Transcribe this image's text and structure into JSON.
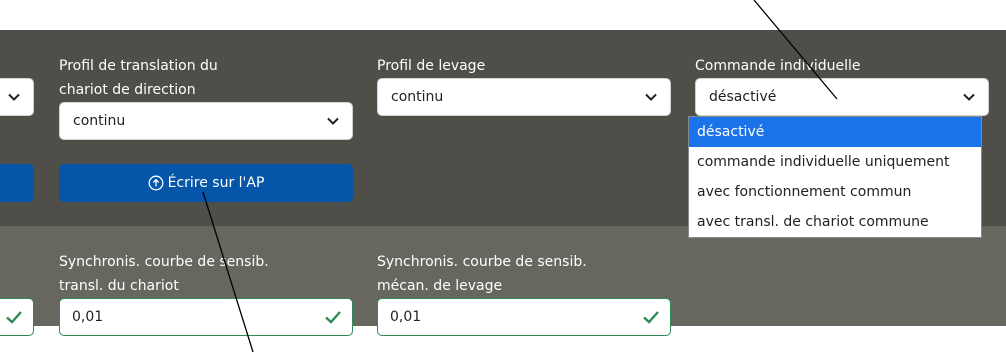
{
  "columns": {
    "col0": {
      "select_value": "",
      "button_label": ""
    },
    "col1": {
      "label_line1": "Profil de translation du",
      "label_line2": "chariot de direction",
      "select_value": "continu",
      "button_label": "Écrire sur l'AP"
    },
    "col2": {
      "label": "Profil de levage",
      "select_value": "continu"
    },
    "col3": {
      "label": "Commande individuelle",
      "select_value": "désactivé",
      "options": [
        "désactivé",
        "commande individuelle uniquement",
        "avec fonctionnement commun",
        "avec transl. de chariot commune"
      ],
      "selected_index": 0
    }
  },
  "lower": {
    "field1": {
      "label_line1": "Synchronis. courbe de sensib.",
      "label_line2": "transl. du chariot",
      "value": "0,01"
    },
    "field2": {
      "label_line1": "Synchronis. courbe de sensib.",
      "label_line2": "mécan. de levage",
      "value": "0,01"
    }
  },
  "icons": {
    "chevron": "chevron-down-icon",
    "upload": "arrow-up-circle-icon",
    "valid": "check-icon"
  },
  "colors": {
    "panel_top": "#4f4e48",
    "panel_bottom": "#68675f",
    "button": "#0556a8",
    "selected_option": "#1a73e8",
    "valid": "#2e8b57"
  }
}
